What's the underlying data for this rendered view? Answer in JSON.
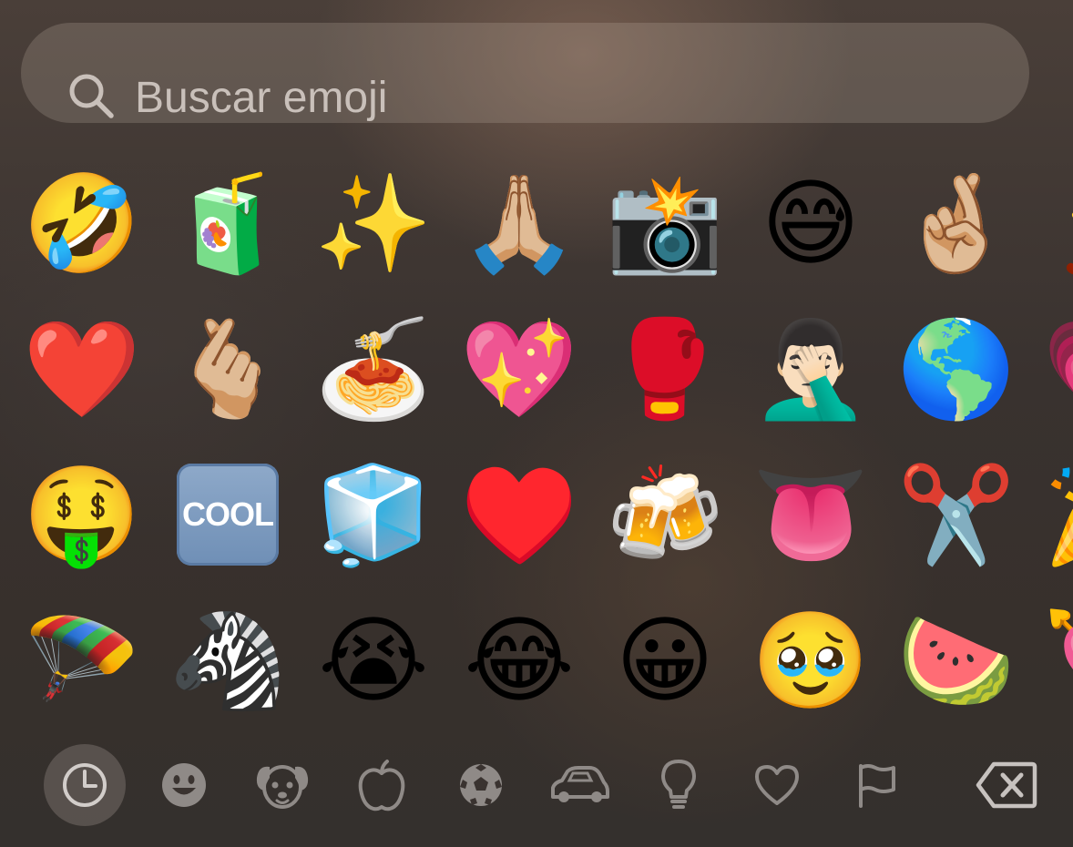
{
  "search": {
    "placeholder": "Buscar emoji",
    "icon": "search-icon"
  },
  "emoji_grid": {
    "rows": [
      [
        {
          "name": "rolling-on-floor-laughing",
          "char": "🤣"
        },
        {
          "name": "beverage-box",
          "char": "🧃"
        },
        {
          "name": "sparkles",
          "char": "✨"
        },
        {
          "name": "folded-hands",
          "char": "🙏🏼"
        },
        {
          "name": "camera-with-flash",
          "char": "📸"
        },
        {
          "name": "grinning-face-with-sweat",
          "char": "😅"
        },
        {
          "name": "crossed-fingers",
          "char": "🤞🏼"
        },
        {
          "name": "partial-emoji",
          "char": "💃"
        }
      ],
      [
        {
          "name": "red-heart",
          "char": "❤️"
        },
        {
          "name": "hand-with-index-finger-and-thumb-crossed",
          "char": "🫰🏼"
        },
        {
          "name": "spaghetti",
          "char": "🍝"
        },
        {
          "name": "sparkling-heart",
          "char": "💖"
        },
        {
          "name": "boxing-glove",
          "char": "🥊"
        },
        {
          "name": "man-facepalming",
          "char": "🤦🏻‍♂️"
        },
        {
          "name": "globe-showing-americas",
          "char": "🌎"
        },
        {
          "name": "partial-emoji",
          "char": "💗"
        }
      ],
      [
        {
          "name": "money-mouth-face",
          "char": "🤑"
        },
        {
          "name": "cool-button",
          "char": "COOL"
        },
        {
          "name": "ice",
          "char": "🧊"
        },
        {
          "name": "red-heart",
          "char": "♥️"
        },
        {
          "name": "clinking-beer-mugs",
          "char": "🍻"
        },
        {
          "name": "tongue",
          "char": "👅"
        },
        {
          "name": "scissors",
          "char": "✂️"
        },
        {
          "name": "partial-emoji",
          "char": "🎉"
        }
      ],
      [
        {
          "name": "parachute",
          "char": "🪂"
        },
        {
          "name": "zebra",
          "char": "🦓"
        },
        {
          "name": "loudly-crying-face",
          "char": "😭"
        },
        {
          "name": "face-with-tears-of-joy",
          "char": "😂"
        },
        {
          "name": "grinning-face",
          "char": "😀"
        },
        {
          "name": "face-holding-back-tears",
          "char": "🥹"
        },
        {
          "name": "watermelon",
          "char": "🍉"
        },
        {
          "name": "partial-emoji",
          "char": "💘"
        }
      ]
    ]
  },
  "tabbar": {
    "tabs": [
      {
        "name": "recent",
        "icon": "clock-icon",
        "active": true
      },
      {
        "name": "smileys",
        "icon": "smiley-icon",
        "active": false
      },
      {
        "name": "animals",
        "icon": "dog-icon",
        "active": false
      },
      {
        "name": "food",
        "icon": "apple-icon",
        "active": false
      },
      {
        "name": "activity",
        "icon": "soccer-ball-icon",
        "active": false
      },
      {
        "name": "travel",
        "icon": "car-icon",
        "active": false
      },
      {
        "name": "objects",
        "icon": "lightbulb-icon",
        "active": false
      },
      {
        "name": "symbols",
        "icon": "heart-icon",
        "active": false
      },
      {
        "name": "flags",
        "icon": "flag-icon",
        "active": false
      }
    ],
    "delete_icon": "backspace-icon"
  },
  "colors": {
    "icon_gray": "#8f8a87",
    "active_tab_bg": "#6e6866",
    "search_text": "#c9c0ba"
  }
}
